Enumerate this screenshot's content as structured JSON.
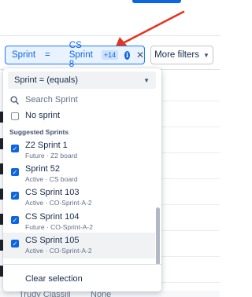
{
  "filter_pill": {
    "field": "Sprint",
    "operator": "=",
    "value": "CS Sprint 8",
    "extra_count": "+14"
  },
  "more_filters": {
    "label": "More filters"
  },
  "dropdown": {
    "operator_select": "Sprint = (equals)",
    "search_placeholder": "Search Sprint",
    "no_sprint": {
      "label": "No sprint",
      "checked": false
    },
    "section_heading": "Suggested Sprints",
    "items": [
      {
        "title": "Z2 Sprint 1",
        "subtitle": "Future · Z2 board",
        "checked": true
      },
      {
        "title": "Sprint 52",
        "subtitle": "Active · CS board",
        "checked": true
      },
      {
        "title": "CS Sprint 103",
        "subtitle": "Active · CO-Sprint-A-2",
        "checked": true
      },
      {
        "title": "CS Sprint 104",
        "subtitle": "Future · CO-Sprint-A-2",
        "checked": true
      },
      {
        "title": "CS Sprint 105",
        "subtitle": "Active · CO-Sprint-A-2",
        "checked": true
      }
    ],
    "clear_label": "Clear selection"
  },
  "background": {
    "bottom_row_name": "Trudy Classill",
    "bottom_row_value": "None"
  },
  "colors": {
    "accent": "#0c66e4",
    "pill_bg": "#e9f2ff",
    "arrow": "#e5341f"
  },
  "icons": [
    "info-icon",
    "close-icon",
    "chevron-down-icon",
    "search-icon",
    "checkbox-checked-icon",
    "arrow-annotation"
  ]
}
